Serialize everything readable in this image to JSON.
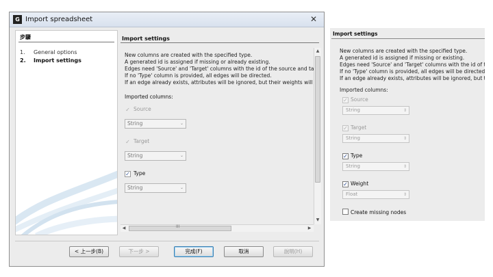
{
  "dialog": {
    "title": "Import spreadsheet",
    "app_icon": "gephi-app-icon",
    "close_glyph": "✕"
  },
  "steps": {
    "heading": "步驟",
    "items": [
      {
        "number": "1.",
        "label": "General options",
        "current": false
      },
      {
        "number": "2.",
        "label": "Import settings",
        "current": true
      }
    ]
  },
  "content": {
    "heading": "Import settings",
    "description": [
      "New columns are created with the specified type.",
      "A generated id is assigned if missing or already existing.",
      "Edges need 'Source' and 'Target' columns with the id of the source and target",
      "If no 'Type' column is provided, all edges will be directed.",
      "If an edge already exists, attributes will be ignored, but their weights will be"
    ],
    "imported_columns_label": "Imported columns:",
    "columns": [
      {
        "name": "Source",
        "checked": true,
        "enabled": false,
        "type": "String"
      },
      {
        "name": "Target",
        "checked": true,
        "enabled": false,
        "type": "String"
      },
      {
        "name": "Type",
        "checked": true,
        "enabled": true,
        "type": "String"
      }
    ],
    "hscroll_grip": "III"
  },
  "buttons": {
    "back": "< 上一步(B)",
    "next": "下一步 >",
    "finish": "完成(F)",
    "cancel": "取消",
    "help": "說明(H)"
  },
  "zoom": {
    "heading": "Import settings",
    "description": [
      "New columns are created with the specified type.",
      "A generated id is assigned if missing or existing.",
      "Edges need 'Source' and 'Target' columns with the id of th",
      "If no 'Type' column is provided, all edges will be directed",
      "If an edge already exists, attributes will be ignored, but t"
    ],
    "imported_columns_label": "Imported columns:",
    "columns": [
      {
        "name": "Source",
        "checked": true,
        "enabled": false,
        "type": "String"
      },
      {
        "name": "Target",
        "checked": true,
        "enabled": false,
        "type": "String"
      },
      {
        "name": "Type",
        "checked": true,
        "enabled": true,
        "type": "String"
      },
      {
        "name": "Weight",
        "checked": true,
        "enabled": true,
        "type": "Float"
      }
    ],
    "create_missing_nodes": {
      "label": "Create missing nodes",
      "checked": false
    }
  },
  "glyphs": {
    "check": "✓",
    "dropdown": "⌄",
    "spinner": "⇕",
    "up": "▲",
    "down": "▼",
    "left": "◀",
    "right": "▶"
  },
  "colors": {
    "titlebar": "#dbe3ef",
    "dialog_bg": "#ececec",
    "default_button_border": "#3c7fb1",
    "checkmark": "#1d3f8a"
  }
}
